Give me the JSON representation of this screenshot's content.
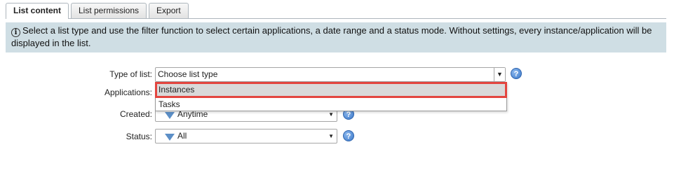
{
  "tabs": [
    {
      "label": "List content",
      "active": true
    },
    {
      "label": "List permissions",
      "active": false
    },
    {
      "label": "Export",
      "active": false
    }
  ],
  "info": {
    "icon": "info-icon",
    "text": "Select a list type and use the filter function to select certain applications, a date range and a status mode. Without settings, every instance/application will be displayed in the list."
  },
  "form": {
    "type_label": "Type of list:",
    "type_value": "Choose list type",
    "applications_label": "Applications:",
    "created_label": "Created:",
    "created_value": "Anytime",
    "status_label": "Status:",
    "status_value": "All"
  },
  "dropdown": {
    "options": [
      {
        "label": "Instances",
        "highlighted": true
      },
      {
        "label": "Tasks",
        "highlighted": false
      }
    ]
  },
  "colors": {
    "info_bg": "#cfdee4",
    "highlight_border": "#e3453f",
    "help_blue": "#3a78c9"
  }
}
